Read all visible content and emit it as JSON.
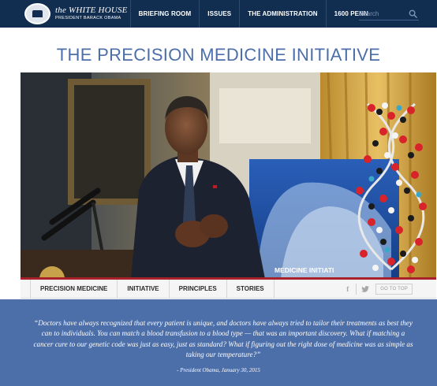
{
  "header": {
    "brand_title": "the WHITE HOUSE",
    "brand_subtitle": "PRESIDENT BARACK OBAMA",
    "nav": [
      {
        "label": "BRIEFING ROOM"
      },
      {
        "label": "ISSUES"
      },
      {
        "label": "THE ADMINISTRATION"
      },
      {
        "label": "1600 PENN"
      }
    ],
    "search_placeholder": "Search",
    "search_icon": "search-icon"
  },
  "page": {
    "title": "THE PRECISION MEDICINE INITIATIVE"
  },
  "hero": {
    "screen_text": "MEDICINE INITIATI"
  },
  "subnav": {
    "tabs": [
      {
        "label": "PRECISION MEDICINE"
      },
      {
        "label": "INITIATIVE"
      },
      {
        "label": "PRINCIPLES"
      },
      {
        "label": "STORIES"
      }
    ],
    "facebook": "f",
    "twitter_icon": "twitter-icon",
    "go_to_top": "GO TO TOP"
  },
  "quote": {
    "text": "“Doctors have always recognized that every patient is unique, and doctors have always tried to tailor their treatments as best they can to individuals. You can match a blood transfusion to a blood type — that was an important discovery. What if matching a cancer cure to our genetic code was just as easy, just as standard? What if figuring out the right dose of medicine was as simple as taking our temperature?”",
    "attribution": "- President Obama, January 30, 2015"
  },
  "colors": {
    "nav_bg": "#112e51",
    "accent_blue": "#4c6ea9",
    "accent_red": "#a7212a"
  }
}
